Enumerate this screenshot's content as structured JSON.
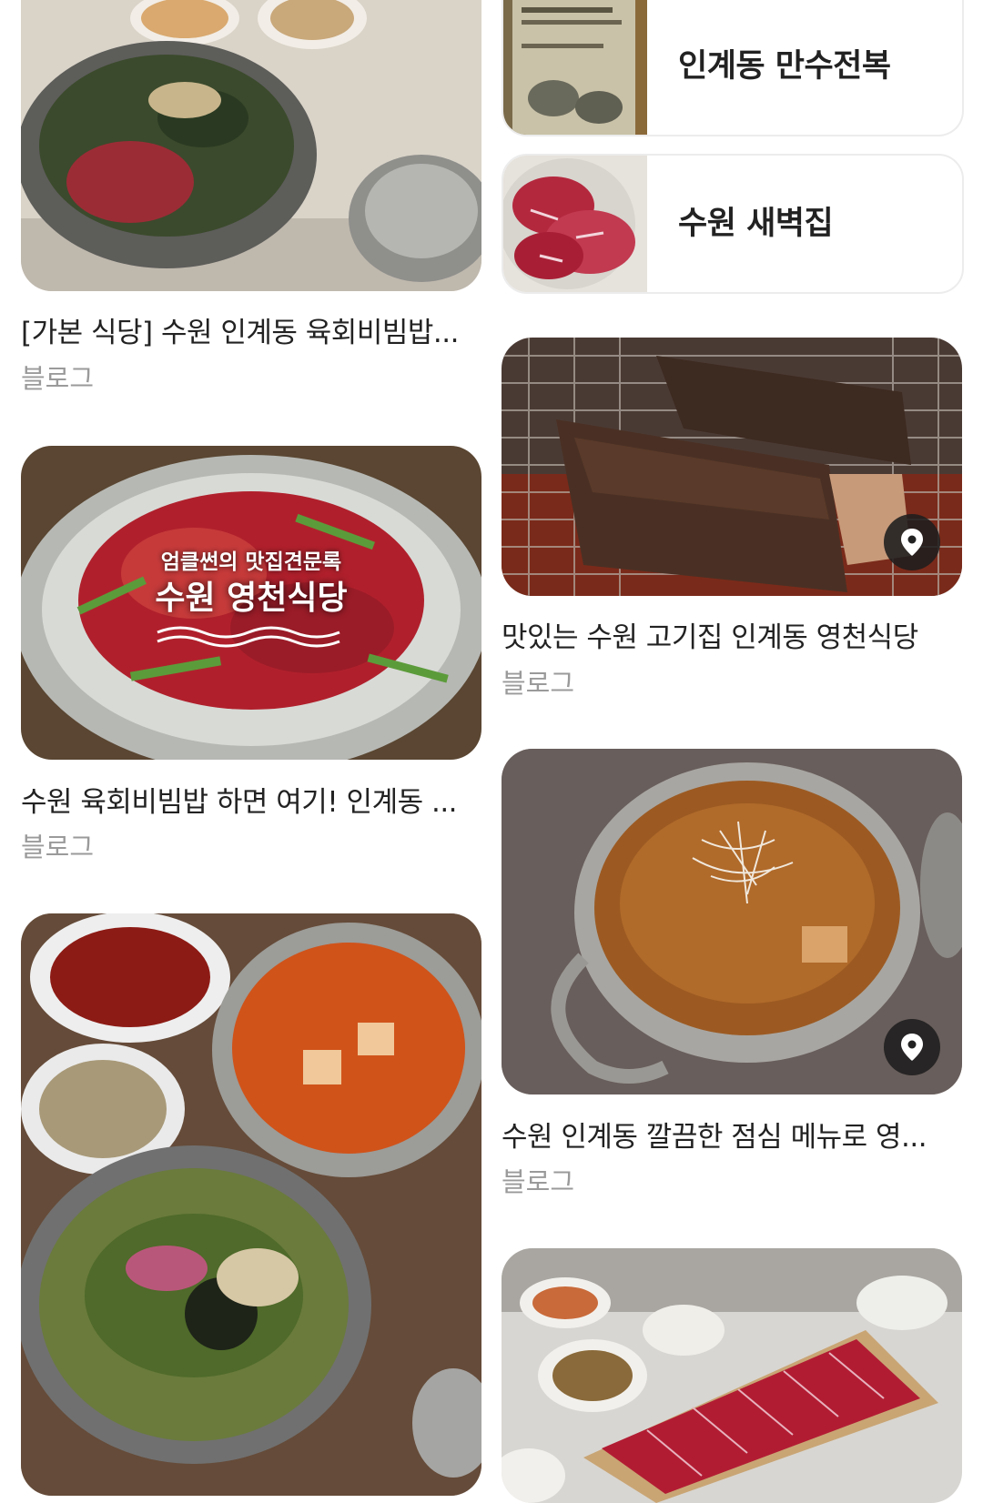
{
  "left_column": [
    {
      "title": "[가본 식당] 수원 인계동 육회비빔밥...",
      "source": "블로그"
    },
    {
      "title": "수원 육회비빔밥 하면 여기! 인계동 ...",
      "source": "블로그",
      "overlay": {
        "line1": "엄클썬의 맛집견문록",
        "line2": "수원 영천식당"
      }
    },
    {
      "title": "",
      "source": ""
    }
  ],
  "right_column": {
    "places": [
      {
        "name": "인계동 만수전복"
      },
      {
        "name": "수원 새벽집"
      }
    ],
    "cards": [
      {
        "title": "맛있는 수원 고기집 인계동 영천식당",
        "source": "블로그"
      },
      {
        "title": "수원 인계동 깔끔한 점심 메뉴로 영...",
        "source": "블로그"
      }
    ]
  }
}
